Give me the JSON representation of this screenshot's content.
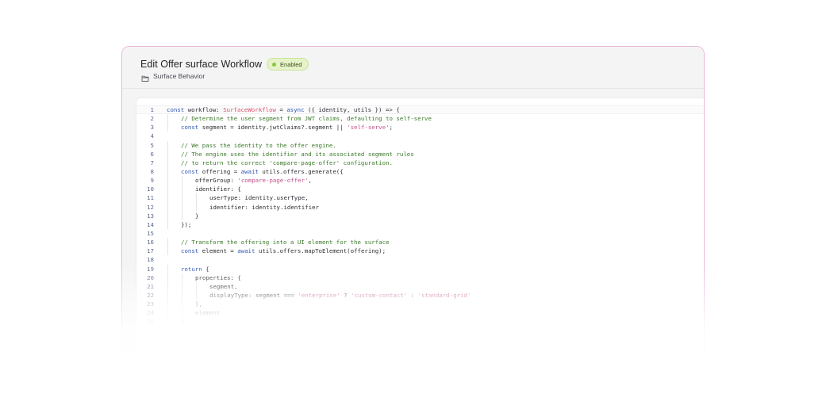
{
  "header": {
    "title": "Edit Offer surface Workflow",
    "status_badge": "Enabled",
    "subtitle": "Surface Behavior",
    "subtitle_icon": "folder-icon"
  },
  "editor": {
    "lines": [
      {
        "n": "1",
        "indent": 0,
        "tokens": [
          [
            "kw",
            "const"
          ],
          [
            "p",
            " workflow: "
          ],
          [
            "type",
            "SurfaceWorkflow"
          ],
          [
            "p",
            " = "
          ],
          [
            "kw",
            "async"
          ],
          [
            "p",
            " ({ identity, utils }) => {"
          ]
        ]
      },
      {
        "n": "2",
        "indent": 1,
        "tokens": [
          [
            "cmt",
            "// Determine the user segment from JWT claims, defaulting to self-serve"
          ]
        ]
      },
      {
        "n": "3",
        "indent": 1,
        "tokens": [
          [
            "kw",
            "const"
          ],
          [
            "p",
            " segment = identity.jwtClaims?.segment || "
          ],
          [
            "str",
            "'self-serve'"
          ],
          [
            "p",
            ";"
          ]
        ]
      },
      {
        "n": "4",
        "indent": 0,
        "tokens": []
      },
      {
        "n": "5",
        "indent": 1,
        "tokens": [
          [
            "cmt",
            "// We pass the identity to the offer engine."
          ]
        ]
      },
      {
        "n": "6",
        "indent": 1,
        "tokens": [
          [
            "cmt",
            "// The engine uses the identifier and its associated segment rules"
          ]
        ]
      },
      {
        "n": "7",
        "indent": 1,
        "tokens": [
          [
            "cmt",
            "// to return the correct 'compare-page-offer' configuration."
          ]
        ]
      },
      {
        "n": "8",
        "indent": 1,
        "tokens": [
          [
            "kw",
            "const"
          ],
          [
            "p",
            " offering = "
          ],
          [
            "kw",
            "await"
          ],
          [
            "p",
            " utils.offers.generate({"
          ]
        ]
      },
      {
        "n": "9",
        "indent": 2,
        "tokens": [
          [
            "p",
            "offerGroup: "
          ],
          [
            "str",
            "'compare-page-offer'"
          ],
          [
            "p",
            ","
          ]
        ]
      },
      {
        "n": "10",
        "indent": 2,
        "tokens": [
          [
            "p",
            "identifier: {"
          ]
        ]
      },
      {
        "n": "11",
        "indent": 3,
        "tokens": [
          [
            "p",
            "userType: identity.userType,"
          ]
        ]
      },
      {
        "n": "12",
        "indent": 3,
        "tokens": [
          [
            "p",
            "identifier: identity.identifier"
          ]
        ]
      },
      {
        "n": "13",
        "indent": 2,
        "tokens": [
          [
            "p",
            "}"
          ]
        ]
      },
      {
        "n": "14",
        "indent": 1,
        "tokens": [
          [
            "p",
            "});"
          ]
        ]
      },
      {
        "n": "15",
        "indent": 0,
        "tokens": []
      },
      {
        "n": "16",
        "indent": 1,
        "tokens": [
          [
            "cmt",
            "// Transform the offering into a UI element for the surface"
          ]
        ]
      },
      {
        "n": "17",
        "indent": 1,
        "tokens": [
          [
            "kw",
            "const"
          ],
          [
            "p",
            " element = "
          ],
          [
            "kw",
            "await"
          ],
          [
            "p",
            " utils.offers.mapToElement(offering);"
          ]
        ]
      },
      {
        "n": "18",
        "indent": 0,
        "tokens": []
      },
      {
        "n": "19",
        "indent": 1,
        "tokens": [
          [
            "kw",
            "return"
          ],
          [
            "p",
            " {"
          ]
        ]
      },
      {
        "n": "20",
        "indent": 2,
        "tokens": [
          [
            "p",
            "properties: {"
          ]
        ]
      },
      {
        "n": "21",
        "indent": 3,
        "tokens": [
          [
            "p",
            "segment,"
          ]
        ]
      },
      {
        "n": "22",
        "indent": 3,
        "tokens": [
          [
            "p",
            "displayType: segment === "
          ],
          [
            "str",
            "'enterprise'"
          ],
          [
            "p",
            " ? "
          ],
          [
            "str",
            "'custom-contact'"
          ],
          [
            "p",
            " : "
          ],
          [
            "str",
            "'standard-grid'"
          ]
        ]
      },
      {
        "n": "23",
        "indent": 2,
        "tokens": [
          [
            "p",
            "},"
          ]
        ]
      },
      {
        "n": "24",
        "indent": 2,
        "tokens": [
          [
            "p",
            "element"
          ]
        ]
      },
      {
        "n": "25",
        "indent": 1,
        "tokens": [
          [
            "p",
            "};"
          ]
        ]
      }
    ]
  },
  "colors": {
    "card_border": "#e9b8de",
    "badge_bg": "#e6f3c9",
    "keyword": "#2f57b5",
    "type": "#d9536a",
    "string": "#c0508a",
    "comment": "#3c7a2a"
  }
}
